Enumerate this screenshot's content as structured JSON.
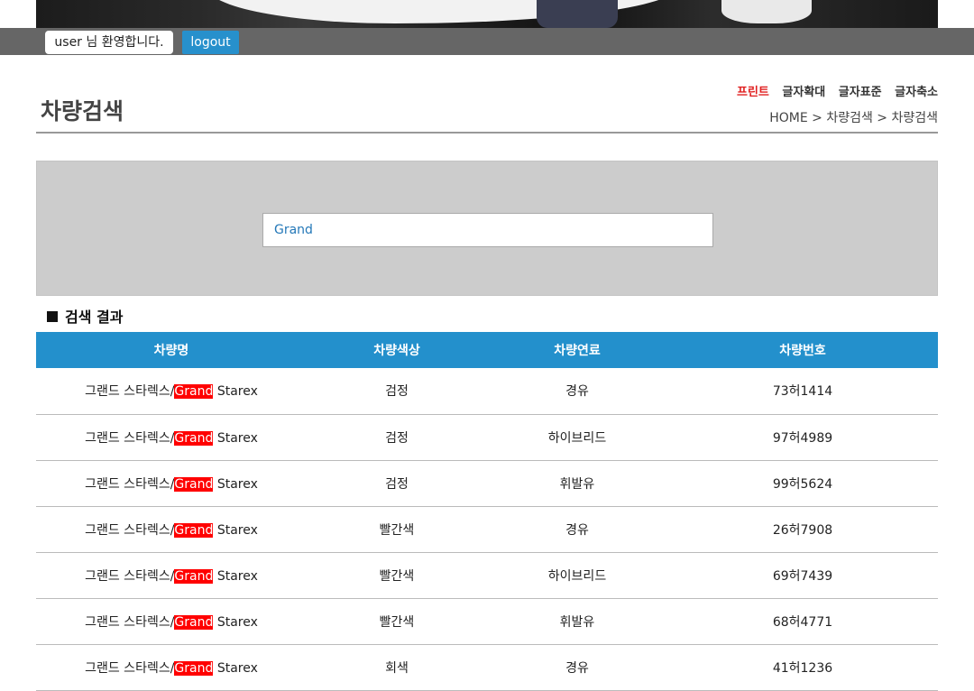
{
  "header": {
    "welcome": "user 님 환영합니다.",
    "logout_label": "logout"
  },
  "page": {
    "title": "차량검색",
    "tools": [
      "프린트",
      "글자확대",
      "글자표준",
      "글자축소"
    ],
    "breadcrumb": "HOME > 차량검색 > 차량검색"
  },
  "search": {
    "value": "Grand"
  },
  "results": {
    "heading": "검색 결과",
    "columns": [
      "차량명",
      "차량색상",
      "차량연료",
      "차량번호"
    ],
    "rows": [
      {
        "name_pre": "그랜드 스타렉스/",
        "name_hl": "Grand",
        "name_post": " Starex",
        "color": "검정",
        "fuel": "경유",
        "plate": "73허1414"
      },
      {
        "name_pre": "그랜드 스타렉스/",
        "name_hl": "Grand",
        "name_post": " Starex",
        "color": "검정",
        "fuel": "하이브리드",
        "plate": "97허4989"
      },
      {
        "name_pre": "그랜드 스타렉스/",
        "name_hl": "Grand",
        "name_post": " Starex",
        "color": "검정",
        "fuel": "휘발유",
        "plate": "99허5624"
      },
      {
        "name_pre": "그랜드 스타렉스/",
        "name_hl": "Grand",
        "name_post": " Starex",
        "color": "빨간색",
        "fuel": "경유",
        "plate": "26허7908"
      },
      {
        "name_pre": "그랜드 스타렉스/",
        "name_hl": "Grand",
        "name_post": " Starex",
        "color": "빨간색",
        "fuel": "하이브리드",
        "plate": "69허7439"
      },
      {
        "name_pre": "그랜드 스타렉스/",
        "name_hl": "Grand",
        "name_post": " Starex",
        "color": "빨간색",
        "fuel": "휘발유",
        "plate": "68허4771"
      },
      {
        "name_pre": "그랜드 스타렉스/",
        "name_hl": "Grand",
        "name_post": " Starex",
        "color": "회색",
        "fuel": "경유",
        "plate": "41허1236"
      }
    ]
  },
  "colors": {
    "accent": "#2390cc",
    "highlight": "#ff0000",
    "print": "#e02020"
  }
}
